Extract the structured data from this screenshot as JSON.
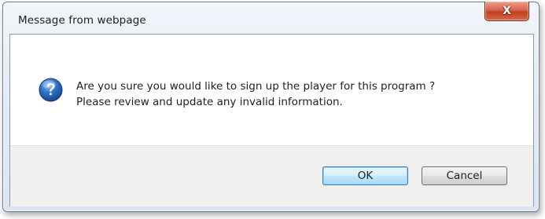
{
  "dialog": {
    "title": "Message from webpage",
    "close_glyph": "X",
    "icon": "question-icon",
    "message_line1": "Are you sure you would like to sign up the player for this program ?",
    "message_line2": "Please review and update any invalid information.",
    "ok_label": "OK",
    "cancel_label": "Cancel"
  },
  "colors": {
    "close_button": "#c3401f",
    "icon_blue": "#1f5fb0",
    "footer_bg": "#f0f0f0"
  }
}
